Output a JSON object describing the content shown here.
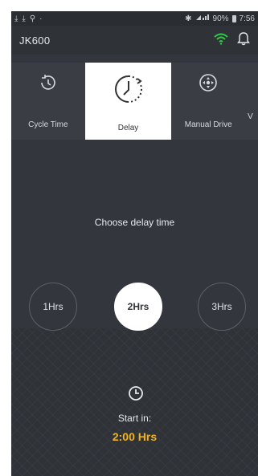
{
  "status_bar": {
    "left_icons": [
      "download-icon",
      "download-icon",
      "usb-icon",
      "dot-icon"
    ],
    "battery": "90%",
    "time": "7:56"
  },
  "header": {
    "title": "JK600",
    "wifi_icon": "wifi-icon",
    "bell_icon": "bell-icon",
    "wifi_color": "#2ecc40"
  },
  "tabs": [
    {
      "label": "Cycle Time",
      "icon": "cycle-time-icon"
    },
    {
      "label": "Delay",
      "icon": "delay-icon",
      "active": true
    },
    {
      "label": "Manual Drive",
      "icon": "manual-drive-icon"
    },
    {
      "label": "V",
      "icon": ""
    }
  ],
  "main": {
    "choose_label": "Choose delay time",
    "options": [
      {
        "label": "1Hrs"
      },
      {
        "label": "2Hrs",
        "selected": true
      },
      {
        "label": "3Hrs"
      }
    ],
    "start_label": "Start in:",
    "start_value": "2:00 Hrs",
    "accent_color": "#f2b21c"
  }
}
